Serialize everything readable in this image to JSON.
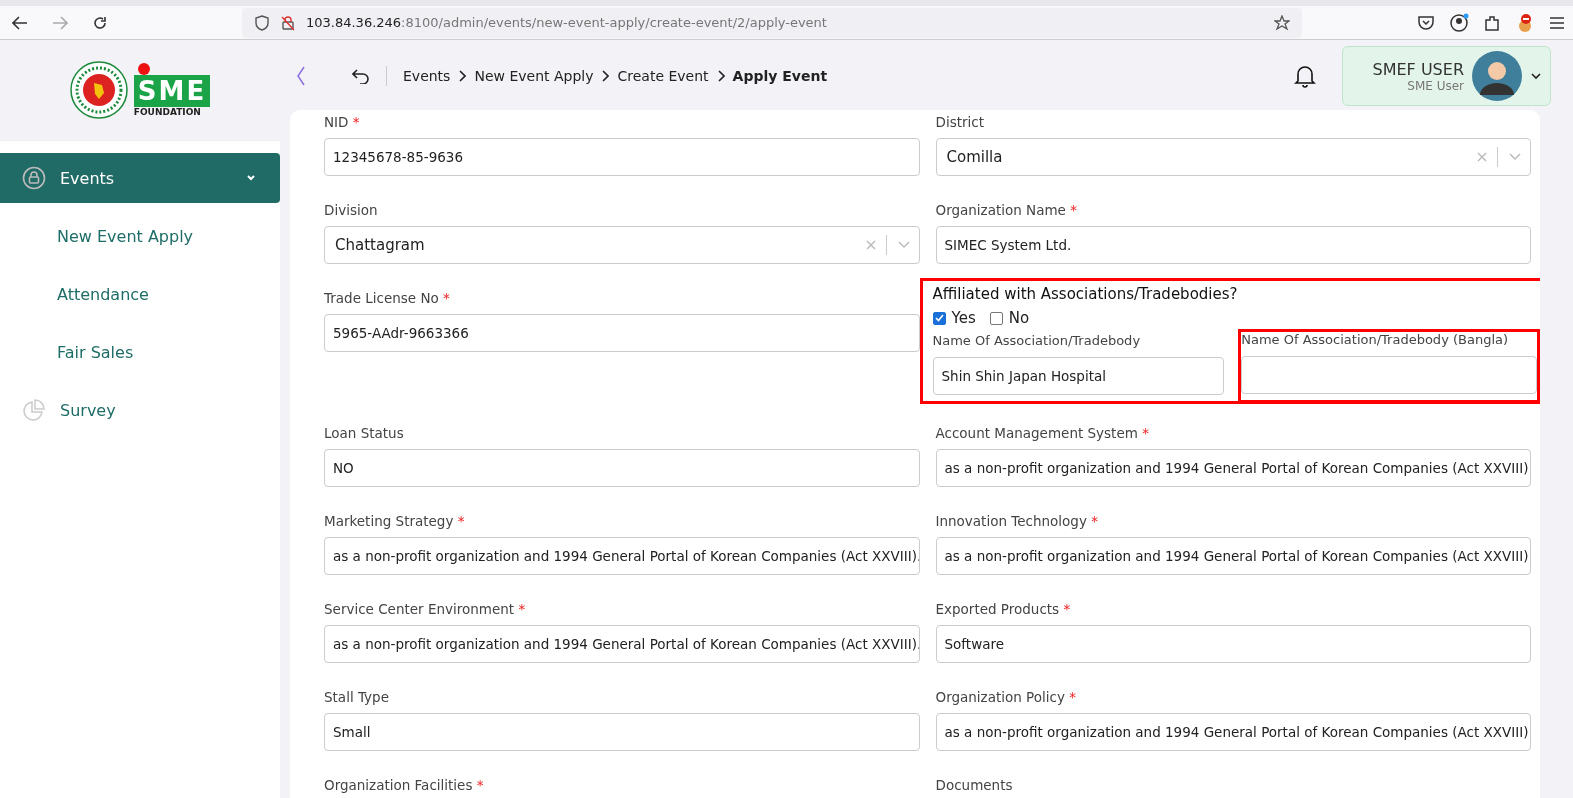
{
  "browser": {
    "url_host": "103.84.36.246",
    "url_path": ":8100/admin/events/new-event-apply/create-event/2/apply-event"
  },
  "sidebar": {
    "logo_text": "FOUNDATION",
    "logo_letters": "SME",
    "items": [
      {
        "label": "Events",
        "selected": true,
        "expanded": true,
        "kind": "group"
      },
      {
        "label": "New Event Apply",
        "selected": false,
        "kind": "sub"
      },
      {
        "label": "Attendance",
        "selected": false,
        "kind": "sub"
      },
      {
        "label": "Fair Sales",
        "selected": false,
        "kind": "sub"
      },
      {
        "label": "Survey",
        "selected": false,
        "kind": "group",
        "expanded": false
      }
    ]
  },
  "breadcrumb": [
    "Events",
    "New Event Apply",
    "Create Event",
    "Apply Event"
  ],
  "user": {
    "name": "SMEF USER",
    "role": "SME User"
  },
  "form": {
    "rows": [
      [
        {
          "kind": "input",
          "label": "NID",
          "required_mark": "*",
          "value": "12345678-85-9636"
        },
        {
          "kind": "select",
          "label": "District",
          "value": "Comilla"
        }
      ],
      [
        {
          "kind": "select",
          "label": "Division",
          "value": "Chattagram"
        },
        {
          "kind": "input",
          "label": "Organization Name",
          "required_mark": "*",
          "value": "SIMEC System Ltd."
        }
      ],
      [
        {
          "kind": "input",
          "label": "Trade License No",
          "required_mark": "*",
          "value": "5965-AAdr-9663366"
        },
        {
          "kind": "affiliation",
          "highlighted": true,
          "question": "Affiliated with Associations/Tradebodies?",
          "options": [
            {
              "label": "Yes",
              "checked": true
            },
            {
              "label": "No",
              "checked": false
            }
          ],
          "fields": [
            {
              "label": "Name Of Association/Tradebody",
              "value": "Shin Shin Japan Hospital",
              "highlighted": false
            },
            {
              "label": "Name Of Association/Tradebody (Bangla)",
              "highlighted": true
            }
          ]
        }
      ],
      [
        {
          "kind": "input",
          "label": "Loan Status",
          "value": "NO"
        },
        {
          "kind": "input",
          "label": "Account Management System",
          "required_mark": "*",
          "value": "as a non-profit organization and 1994 General Portal of Korean Companies (Act XXVIII)."
        }
      ],
      [
        {
          "kind": "input",
          "label": "Marketing Strategy",
          "required_mark": "*",
          "value": "as a non-profit organization and 1994 General Portal of Korean Companies (Act XXVIII)."
        },
        {
          "kind": "input",
          "label": "Innovation Technology",
          "required_mark": "*",
          "value": "as a non-profit organization and 1994 General Portal of Korean Companies (Act XXVIII)."
        }
      ],
      [
        {
          "kind": "input",
          "label": "Service Center Environment",
          "required_mark": "*",
          "value": "as a non-profit organization and 1994 General Portal of Korean Companies (Act XXVIII)."
        },
        {
          "kind": "input",
          "label": "Exported Products",
          "required_mark": "*",
          "value": "Software"
        }
      ],
      [
        {
          "kind": "input",
          "label": "Stall Type",
          "value": "Small"
        },
        {
          "kind": "input",
          "label": "Organization Policy",
          "required_mark": "*",
          "value": "as a non-profit organization and 1994 General Portal of Korean Companies (Act XXVIII)."
        }
      ],
      [
        {
          "kind": "label",
          "label": "Organization Facilities",
          "required_mark": "*"
        },
        {
          "kind": "label",
          "label": "Documents"
        }
      ]
    ]
  }
}
